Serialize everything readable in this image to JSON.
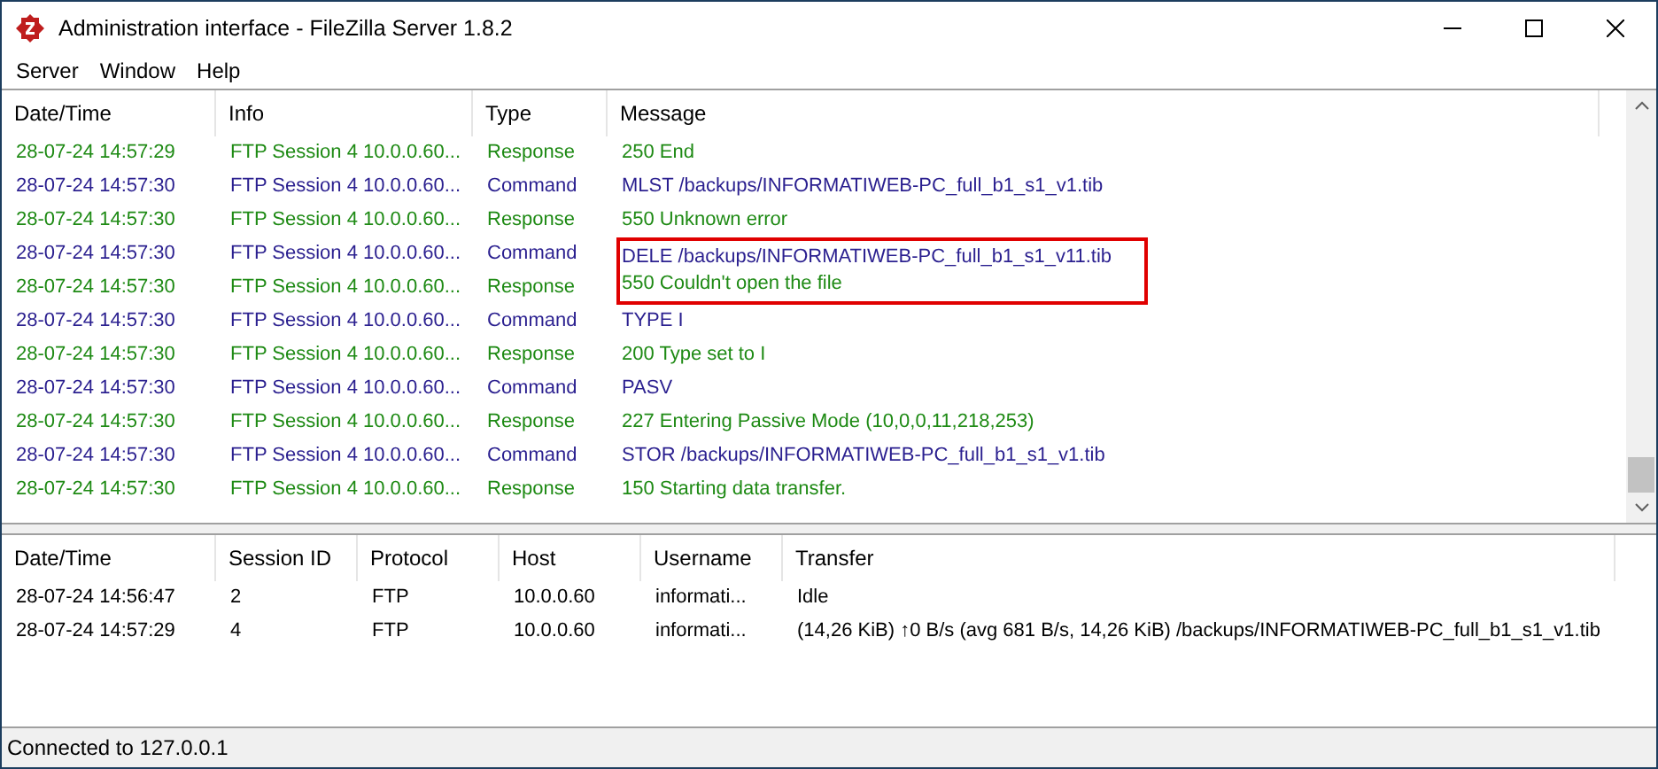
{
  "window": {
    "title": "Administration interface - FileZilla Server 1.8.2"
  },
  "menu": [
    "Server",
    "Window",
    "Help"
  ],
  "log": {
    "columns": [
      "Date/Time",
      "Info",
      "Type",
      "Message"
    ],
    "rows": [
      {
        "kind": "response",
        "datetime": "28-07-24 14:57:29",
        "info": "FTP Session 4 10.0.0.60...",
        "type": "Response",
        "message": "250 End",
        "highlighted": false
      },
      {
        "kind": "command",
        "datetime": "28-07-24 14:57:30",
        "info": "FTP Session 4 10.0.0.60...",
        "type": "Command",
        "message": "MLST /backups/INFORMATIWEB-PC_full_b1_s1_v1.tib",
        "highlighted": false
      },
      {
        "kind": "response",
        "datetime": "28-07-24 14:57:30",
        "info": "FTP Session 4 10.0.0.60...",
        "type": "Response",
        "message": "550 Unknown error",
        "highlighted": false
      },
      {
        "kind": "command",
        "datetime": "28-07-24 14:57:30",
        "info": "FTP Session 4 10.0.0.60...",
        "type": "Command",
        "message": "DELE /backups/INFORMATIWEB-PC_full_b1_s1_v11.tib",
        "highlighted": true
      },
      {
        "kind": "response",
        "datetime": "28-07-24 14:57:30",
        "info": "FTP Session 4 10.0.0.60...",
        "type": "Response",
        "message": "550 Couldn't open the file",
        "highlighted": true
      },
      {
        "kind": "command",
        "datetime": "28-07-24 14:57:30",
        "info": "FTP Session 4 10.0.0.60...",
        "type": "Command",
        "message": "TYPE I",
        "highlighted": false
      },
      {
        "kind": "response",
        "datetime": "28-07-24 14:57:30",
        "info": "FTP Session 4 10.0.0.60...",
        "type": "Response",
        "message": "200 Type set to I",
        "highlighted": false
      },
      {
        "kind": "command",
        "datetime": "28-07-24 14:57:30",
        "info": "FTP Session 4 10.0.0.60...",
        "type": "Command",
        "message": "PASV",
        "highlighted": false
      },
      {
        "kind": "response",
        "datetime": "28-07-24 14:57:30",
        "info": "FTP Session 4 10.0.0.60...",
        "type": "Response",
        "message": "227 Entering Passive Mode (10,0,0,11,218,253)",
        "highlighted": false
      },
      {
        "kind": "command",
        "datetime": "28-07-24 14:57:30",
        "info": "FTP Session 4 10.0.0.60...",
        "type": "Command",
        "message": "STOR /backups/INFORMATIWEB-PC_full_b1_s1_v1.tib",
        "highlighted": false
      },
      {
        "kind": "response",
        "datetime": "28-07-24 14:57:30",
        "info": "FTP Session 4 10.0.0.60...",
        "type": "Response",
        "message": "150 Starting data transfer.",
        "highlighted": false
      }
    ]
  },
  "sessions": {
    "columns": [
      "Date/Time",
      "Session ID",
      "Protocol",
      "Host",
      "Username",
      "Transfer"
    ],
    "rows": [
      [
        "28-07-24 14:56:47",
        "2",
        "FTP",
        "10.0.0.60",
        "informati...",
        "Idle"
      ],
      [
        "28-07-24 14:57:29",
        "4",
        "FTP",
        "10.0.0.60",
        "informati...",
        "(14,26 KiB) ↑0 B/s (avg 681 B/s, 14,26 KiB) /backups/INFORMATIWEB-PC_full_b1_s1_v1.tib"
      ]
    ]
  },
  "status_bar": "Connected to 127.0.0.1"
}
